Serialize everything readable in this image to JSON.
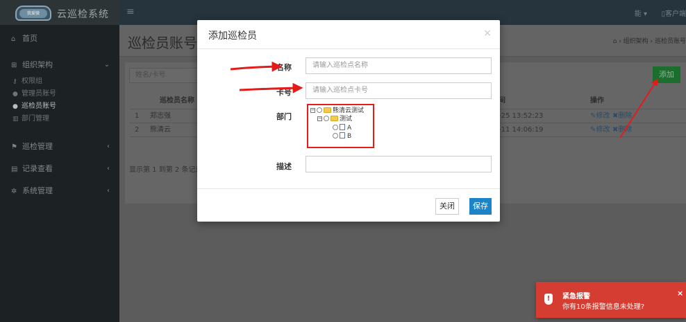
{
  "sidebar": {
    "logo_badge": "我爱微",
    "app_title": "云巡检系统",
    "items": [
      {
        "label": "首页",
        "icon": "home-icon"
      },
      {
        "label": "组织架构",
        "icon": "sitemap-icon"
      },
      {
        "label": "巡检管理",
        "icon": "route-icon"
      },
      {
        "label": "记录查看",
        "icon": "chart-icon"
      },
      {
        "label": "系统管理",
        "icon": "gear-icon"
      }
    ],
    "sub_items": [
      {
        "label": "权限组",
        "icon": "key-icon"
      },
      {
        "label": "管理员账号",
        "icon": "user-icon"
      },
      {
        "label": "巡检员账号",
        "icon": "user-icon"
      },
      {
        "label": "部门管理",
        "icon": "building-icon"
      }
    ]
  },
  "topbar": {
    "user": "能 ▾",
    "client": "客户端"
  },
  "page": {
    "title": "巡检员账号",
    "breadcrumb": [
      "组织架构",
      "巡检员账号"
    ],
    "search_placeholder": "姓名/卡号",
    "add_label": "添加",
    "columns": [
      "巡检员名称",
      "间",
      "操作"
    ],
    "rows": [
      {
        "index": "1",
        "name": "郑志强",
        "time": "-25 13:52:23",
        "edit": "修改",
        "del": "删除"
      },
      {
        "index": "2",
        "name": "熊清云",
        "time": "-11 14:06:19",
        "edit": "修改",
        "del": "删除"
      }
    ],
    "footer": "显示第 1 到第 2 条记录"
  },
  "modal": {
    "title": "添加巡检员",
    "close": "×",
    "name_label": "名称",
    "name_placeholder": "请输入巡检点名称",
    "card_label": "卡号",
    "card_placeholder": "请输入巡检点卡号",
    "dept_label": "部门",
    "desc_label": "描述",
    "tree": {
      "root": "熊清云测试",
      "child": "测试",
      "leaves": [
        "A",
        "B"
      ]
    },
    "close_btn": "关闭",
    "save_btn": "保存"
  },
  "alert": {
    "title": "紧急报警",
    "message": "你有10条报警信息未处理?",
    "close": "×"
  },
  "colors": {
    "annotation": "#e21b1b",
    "save": "#1c84c6",
    "alert": "#d63d32"
  }
}
